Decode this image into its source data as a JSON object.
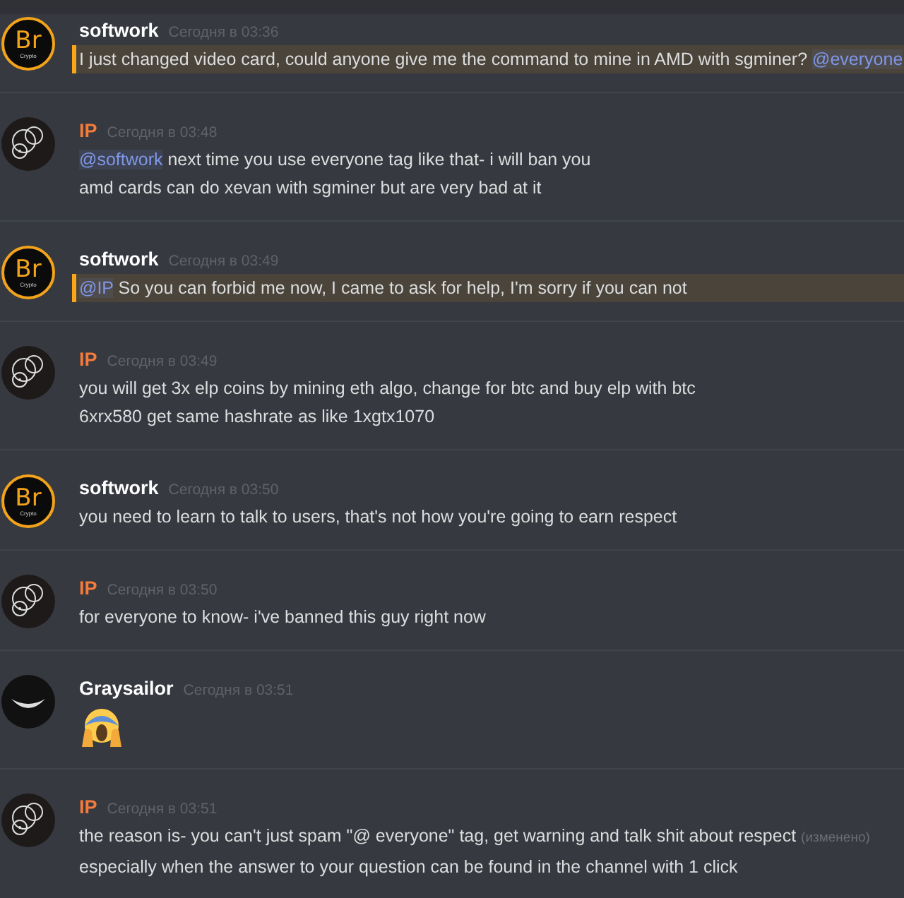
{
  "messages": [
    {
      "author": {
        "name": "softwork",
        "color": "#ffffff"
      },
      "avatar": {
        "kind": "logo",
        "text": "Br",
        "subtext": "Crypto"
      },
      "time": "Сегодня в 03:36",
      "highlighted": true,
      "lines": [
        [
          {
            "kind": "text",
            "text": "I just changed video card, could anyone give me the command to mine in AMD with sgminer? "
          },
          {
            "kind": "mention",
            "text": "@everyone"
          }
        ]
      ]
    },
    {
      "author": {
        "name": "IP",
        "color": "#f37b3c"
      },
      "avatar": {
        "kind": "circles"
      },
      "time": "Сегодня в 03:48",
      "highlighted": false,
      "lines": [
        [
          {
            "kind": "mention",
            "text": "@softwork"
          },
          {
            "kind": "text",
            "text": " next time you use everyone tag like that- i will ban you"
          }
        ],
        [
          {
            "kind": "text",
            "text": "amd cards can do xevan with sgminer but are very bad at it"
          }
        ]
      ]
    },
    {
      "author": {
        "name": "softwork",
        "color": "#ffffff"
      },
      "avatar": {
        "kind": "logo",
        "text": "Br",
        "subtext": "Crypto"
      },
      "time": "Сегодня в 03:49",
      "highlighted": true,
      "lines": [
        [
          {
            "kind": "mention",
            "text": "@IP"
          },
          {
            "kind": "text",
            "text": " So you can forbid me now, I came to ask for help, I'm sorry if you can not"
          }
        ]
      ]
    },
    {
      "author": {
        "name": "IP",
        "color": "#f37b3c"
      },
      "avatar": {
        "kind": "circles"
      },
      "time": "Сегодня в 03:49",
      "highlighted": false,
      "lines": [
        [
          {
            "kind": "text",
            "text": "you will get 3x elp  coins by mining eth algo, change for btc and buy elp with btc"
          }
        ],
        [
          {
            "kind": "text",
            "text": "6xrx580 get same hashrate as like 1xgtx1070"
          }
        ]
      ]
    },
    {
      "author": {
        "name": "softwork",
        "color": "#ffffff"
      },
      "avatar": {
        "kind": "logo",
        "text": "Br",
        "subtext": "Crypto"
      },
      "time": "Сегодня в 03:50",
      "highlighted": false,
      "lines": [
        [
          {
            "kind": "text",
            "text": "you need to learn to talk to users, that's not how you're going to earn respect"
          }
        ]
      ]
    },
    {
      "author": {
        "name": "IP",
        "color": "#f37b3c"
      },
      "avatar": {
        "kind": "circles"
      },
      "time": "Сегодня в 03:50",
      "highlighted": false,
      "lines": [
        [
          {
            "kind": "text",
            "text": "for everyone to know- i've banned this guy right now"
          }
        ]
      ]
    },
    {
      "author": {
        "name": "Graysailor",
        "color": "#ffffff"
      },
      "avatar": {
        "kind": "dark"
      },
      "time": "Сегодня в 03:51",
      "highlighted": false,
      "lines": [
        [
          {
            "kind": "emoji"
          }
        ]
      ]
    },
    {
      "author": {
        "name": "IP",
        "color": "#f37b3c"
      },
      "avatar": {
        "kind": "circles"
      },
      "time": "Сегодня в 03:51",
      "highlighted": false,
      "lines": [
        [
          {
            "kind": "text",
            "text": "the reason is- you can't just spam \"@ everyone\" tag, get warning and talk shit about respect "
          },
          {
            "kind": "edited",
            "text": "(изменено)"
          }
        ],
        [
          {
            "kind": "text",
            "text": "especially when the answer to your question can be found in the channel with 1 click"
          }
        ]
      ]
    }
  ]
}
